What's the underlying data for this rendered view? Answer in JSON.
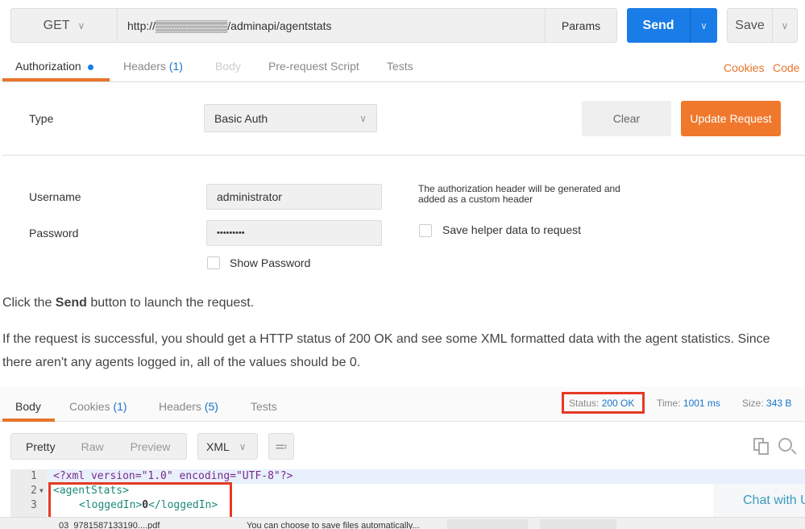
{
  "request_bar": {
    "method": "GET",
    "url": "http://▒▒▒▒▒▒▒▒▒/adminapi/agentstats",
    "params": "Params",
    "send": "Send",
    "save": "Save"
  },
  "request_tabs": [
    {
      "label": "Authorization",
      "active": true
    },
    {
      "label": "Headers",
      "count": "(1)"
    },
    {
      "label": "Body",
      "disabled": true
    },
    {
      "label": "Pre-request Script"
    },
    {
      "label": "Tests"
    }
  ],
  "request_links": {
    "cookies": "Cookies",
    "code": "Code"
  },
  "auth": {
    "type_label": "Type",
    "type_value": "Basic Auth",
    "clear": "Clear",
    "update": "Update Request",
    "username_label": "Username",
    "username_value": "administrator",
    "password_label": "Password",
    "password_value": "•••••••••",
    "show_password": "Show Password",
    "info_line1": "The authorization header will be generated and",
    "info_line2": "added as a custom header",
    "save_helper": "Save helper data to request"
  },
  "doc": {
    "p1_pre": "Click the ",
    "p1_bold": "Send",
    "p1_post": " button to launch the request.",
    "p2_line1": "If the request is successful, you should get a HTTP status of 200 OK and see some XML formatted data with the agent statistics. Since",
    "p2_line2": "there aren't any agents logged in, all of the values should be 0."
  },
  "response_tabs": [
    {
      "label": "Body",
      "active": true
    },
    {
      "label": "Cookies",
      "count": "(1)"
    },
    {
      "label": "Headers",
      "count": "(5)"
    },
    {
      "label": "Tests"
    }
  ],
  "response_meta": {
    "status_label": "Status:",
    "status_value": "200 OK",
    "time_label": "Time:",
    "time_value": "1001 ms",
    "size_label": "Size:",
    "size_value": "343 B"
  },
  "view_modes": [
    "Pretty",
    "Raw",
    "Preview"
  ],
  "format": "XML",
  "code_lines": [
    {
      "num": "1",
      "text": "<?xml version=\"1.0\" encoding=\"UTF-8\"?>"
    },
    {
      "num": "2",
      "text": "<agentStats>"
    },
    {
      "num": "3",
      "open": "<loggedIn>",
      "value": "0",
      "close": "</loggedIn>"
    }
  ],
  "chat": "Chat with U",
  "download_bar": {
    "file": "03_9781587133190....pdf",
    "message": "You can choose to save files automatically..."
  },
  "colors": {
    "accent": "#e8742a",
    "send": "#1a7ce6",
    "highlight": "#e53a24"
  }
}
